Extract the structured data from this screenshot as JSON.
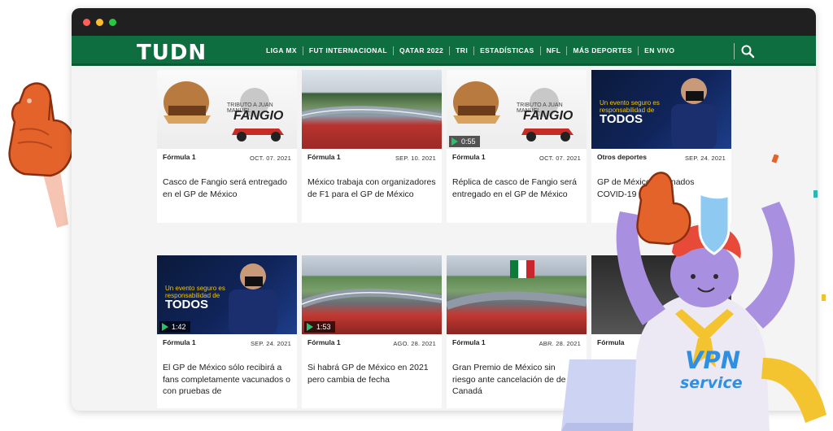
{
  "browser": {
    "window_buttons": [
      "close",
      "minimize",
      "maximize"
    ]
  },
  "site": {
    "logo": "TUDN",
    "nav": [
      "LIGA MX",
      "FUT INTERNACIONAL",
      "QATAR 2022",
      "TRI",
      "ESTADÍSTICAS",
      "NFL",
      "MÁS DEPORTES",
      "EN VIVO"
    ],
    "search_icon": "search-icon"
  },
  "cards": [
    {
      "category": "Fórmula 1",
      "date": "OCT. 07. 2021",
      "title": "Casco de Fangio será entregado en el GP de México",
      "thumb_text": "FANGIO",
      "thumb_caption": "TRIBUTO A JUAN MANUEL"
    },
    {
      "category": "Fórmula 1",
      "date": "SEP. 10. 2021",
      "title": "México trabaja con organizadores de F1 para el GP de México"
    },
    {
      "category": "Fórmula 1",
      "date": "OCT. 07. 2021",
      "title": "Réplica de casco de Fangio será entregado en el GP de México",
      "duration": "0:55",
      "thumb_text": "FANGIO",
      "thumb_caption": "TRIBUTO A JUAN MANUEL"
    },
    {
      "category": "Otros deportes",
      "date": "SEP. 24. 2021",
      "title": "GP de México vacunados COVID-19",
      "thumb_line1": "Un evento seguro es",
      "thumb_line2": "responsabilidad de",
      "thumb_line3": "TODOS"
    },
    {
      "category": "Fórmula 1",
      "date": "SEP. 24. 2021",
      "title": "El GP de México sólo recibirá a fans completamente vacunados o con pruebas de",
      "duration": "1:42",
      "thumb_line1": "Un evento seguro es",
      "thumb_line2": "responsabilidad de",
      "thumb_line3": "TODOS"
    },
    {
      "category": "Fórmula 1",
      "date": "AGO. 28. 2021",
      "title": "Si habrá GP de México en 2021 pero cambia de fecha",
      "duration": "1:53"
    },
    {
      "category": "Fórmula 1",
      "date": "ABR. 28. 2021",
      "title": "Gran Premio de México sin riesgo ante cancelación de de Canadá"
    },
    {
      "category": "Fórmula",
      "date": "",
      "title": ""
    }
  ],
  "overlay": {
    "badge_line1": "VPN",
    "badge_line2": "service"
  },
  "colors": {
    "nav_green": "#0f6e3f",
    "accent_orange": "#e3632a",
    "play_green": "#27c26c"
  }
}
